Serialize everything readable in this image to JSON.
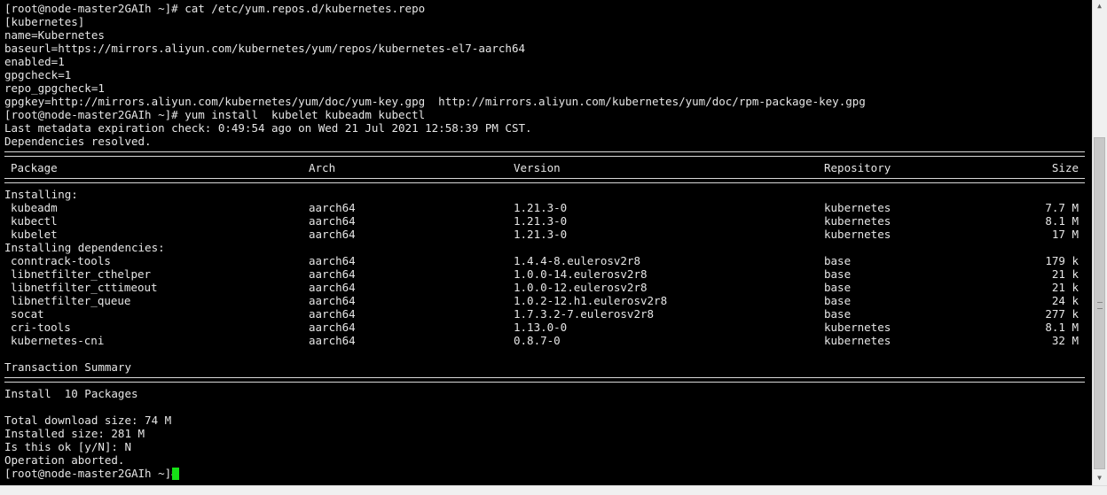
{
  "terminal": {
    "prompt_cmd1": "[root@node-master2GAIh ~]# cat /etc/yum.repos.d/kubernetes.repo",
    "repo_lines": [
      "[kubernetes]",
      "name=Kubernetes",
      "baseurl=https://mirrors.aliyun.com/kubernetes/yum/repos/kubernetes-el7-aarch64",
      "enabled=1",
      "gpgcheck=1",
      "repo_gpgcheck=1",
      "gpgkey=http://mirrors.aliyun.com/kubernetes/yum/doc/yum-key.gpg  http://mirrors.aliyun.com/kubernetes/yum/doc/rpm-package-key.gpg"
    ],
    "prompt_cmd2": "[root@node-master2GAIh ~]# yum install  kubelet kubeadm kubectl",
    "metadata_line": "Last metadata expiration check: 0:49:54 ago on Wed 21 Jul 2021 12:58:39 PM CST.",
    "deps_resolved": "Dependencies resolved.",
    "headers": {
      "package": "Package",
      "arch": "Arch",
      "version": "Version",
      "repository": "Repository",
      "size": "Size"
    },
    "installing_label": "Installing:",
    "installing": [
      {
        "package": "kubeadm",
        "arch": "aarch64",
        "version": "1.21.3-0",
        "repository": "kubernetes",
        "size": "7.7 M"
      },
      {
        "package": "kubectl",
        "arch": "aarch64",
        "version": "1.21.3-0",
        "repository": "kubernetes",
        "size": "8.1 M"
      },
      {
        "package": "kubelet",
        "arch": "aarch64",
        "version": "1.21.3-0",
        "repository": "kubernetes",
        "size": "17 M"
      }
    ],
    "deps_label": "Installing dependencies:",
    "dependencies": [
      {
        "package": "conntrack-tools",
        "arch": "aarch64",
        "version": "1.4.4-8.eulerosv2r8",
        "repository": "base",
        "size": "179 k"
      },
      {
        "package": "libnetfilter_cthelper",
        "arch": "aarch64",
        "version": "1.0.0-14.eulerosv2r8",
        "repository": "base",
        "size": "21 k"
      },
      {
        "package": "libnetfilter_cttimeout",
        "arch": "aarch64",
        "version": "1.0.0-12.eulerosv2r8",
        "repository": "base",
        "size": "21 k"
      },
      {
        "package": "libnetfilter_queue",
        "arch": "aarch64",
        "version": "1.0.2-12.h1.eulerosv2r8",
        "repository": "base",
        "size": "24 k"
      },
      {
        "package": "socat",
        "arch": "aarch64",
        "version": "1.7.3.2-7.eulerosv2r8",
        "repository": "base",
        "size": "277 k"
      },
      {
        "package": "cri-tools",
        "arch": "aarch64",
        "version": "1.13.0-0",
        "repository": "kubernetes",
        "size": "8.1 M"
      },
      {
        "package": "kubernetes-cni",
        "arch": "aarch64",
        "version": "0.8.7-0",
        "repository": "kubernetes",
        "size": "32 M"
      }
    ],
    "transaction_summary": "Transaction Summary",
    "install_count": "Install  10 Packages",
    "total_download": "Total download size: 74 M",
    "installed_size": "Installed size: 281 M",
    "confirm_prompt": "Is this ok [y/N]: N",
    "aborted": "Operation aborted.",
    "final_prompt": "[root@node-master2GAIh ~]# "
  },
  "colors": {
    "background": "#000000",
    "text": "#e6e6e6",
    "cursor": "#16e216",
    "scrollbar": "#f0f0f0"
  },
  "icons": {
    "scroll_up": "triangle-up-icon",
    "scroll_down": "triangle-down-icon"
  }
}
